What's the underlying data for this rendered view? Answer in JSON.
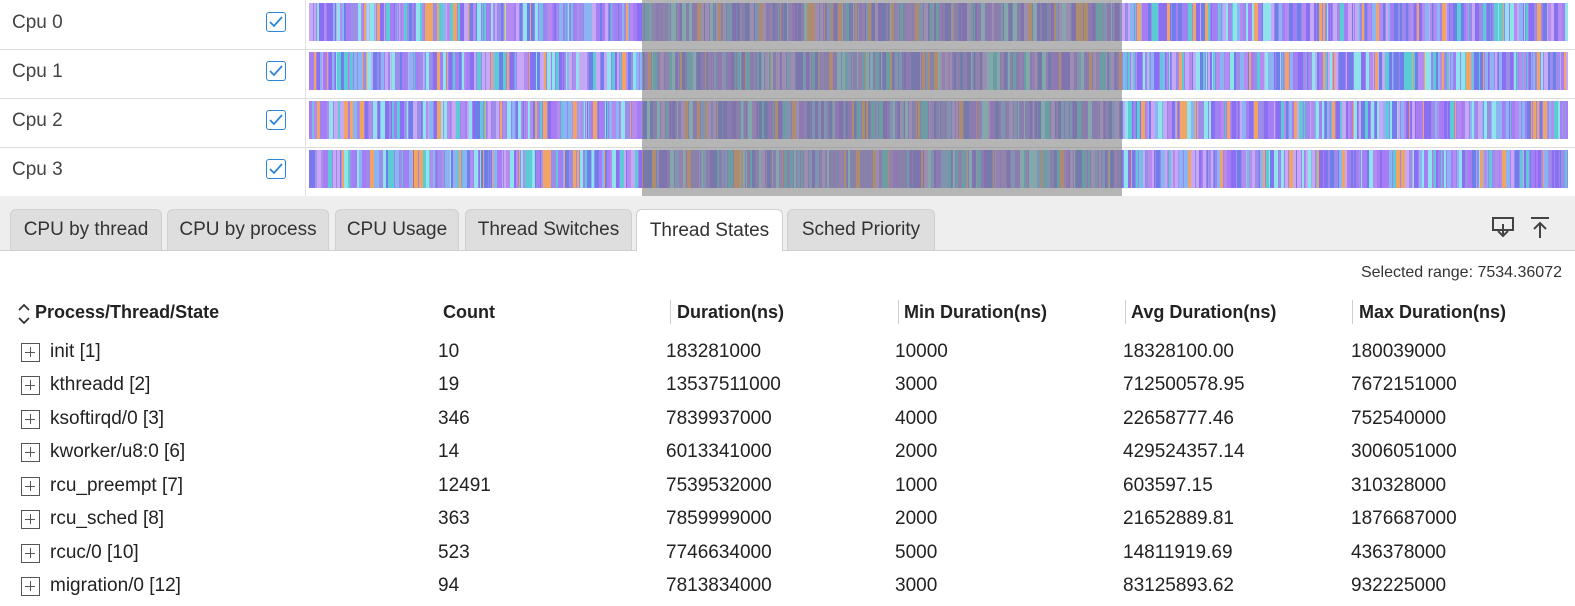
{
  "tracks": [
    {
      "label": "Cpu 0",
      "checked": true
    },
    {
      "label": "Cpu 1",
      "checked": true
    },
    {
      "label": "Cpu 2",
      "checked": true
    },
    {
      "label": "Cpu 3",
      "checked": true
    }
  ],
  "track_palette": [
    "#a77cf5",
    "#8b6ff2",
    "#6f7fe9",
    "#b48cf0",
    "#5ccbd6",
    "#8fe3ea",
    "#f0a566",
    "#8ab4f2",
    "#9c8ee8",
    "#c6a8f5"
  ],
  "tabs": [
    {
      "label": "CPU by thread",
      "active": false
    },
    {
      "label": "CPU by process",
      "active": false
    },
    {
      "label": "CPU Usage",
      "active": false
    },
    {
      "label": "Thread Switches",
      "active": false
    },
    {
      "label": "Thread States",
      "active": true
    },
    {
      "label": "Sched Priority",
      "active": false
    }
  ],
  "toolbar": {
    "download_icon": "download-icon",
    "collapse_icon": "collapse-up-icon"
  },
  "selected_range": "Selected range: 7534.36072",
  "table": {
    "headers": [
      "Process/Thread/State",
      "Count",
      "Duration(ns)",
      "Min Duration(ns)",
      "Avg Duration(ns)",
      "Max Duration(ns)"
    ],
    "rows": [
      {
        "name": "init [1]",
        "count": "10",
        "duration": "183281000",
        "min": "10000",
        "avg": "18328100.00",
        "max": "180039000"
      },
      {
        "name": "kthreadd [2]",
        "count": "19",
        "duration": "13537511000",
        "min": "3000",
        "avg": "712500578.95",
        "max": "7672151000"
      },
      {
        "name": "ksoftirqd/0 [3]",
        "count": "346",
        "duration": "7839937000",
        "min": "4000",
        "avg": "22658777.46",
        "max": "752540000"
      },
      {
        "name": "kworker/u8:0 [6]",
        "count": "14",
        "duration": "6013341000",
        "min": "2000",
        "avg": "429524357.14",
        "max": "3006051000"
      },
      {
        "name": "rcu_preempt [7]",
        "count": "12491",
        "duration": "7539532000",
        "min": "1000",
        "avg": "603597.15",
        "max": "310328000"
      },
      {
        "name": "rcu_sched [8]",
        "count": "363",
        "duration": "7859999000",
        "min": "2000",
        "avg": "21652889.81",
        "max": "1876687000"
      },
      {
        "name": "rcuc/0 [10]",
        "count": "523",
        "duration": "7746634000",
        "min": "5000",
        "avg": "14811919.69",
        "max": "436378000"
      },
      {
        "name": "migration/0 [12]",
        "count": "94",
        "duration": "7813834000",
        "min": "3000",
        "avg": "83125893.62",
        "max": "932225000"
      }
    ]
  }
}
